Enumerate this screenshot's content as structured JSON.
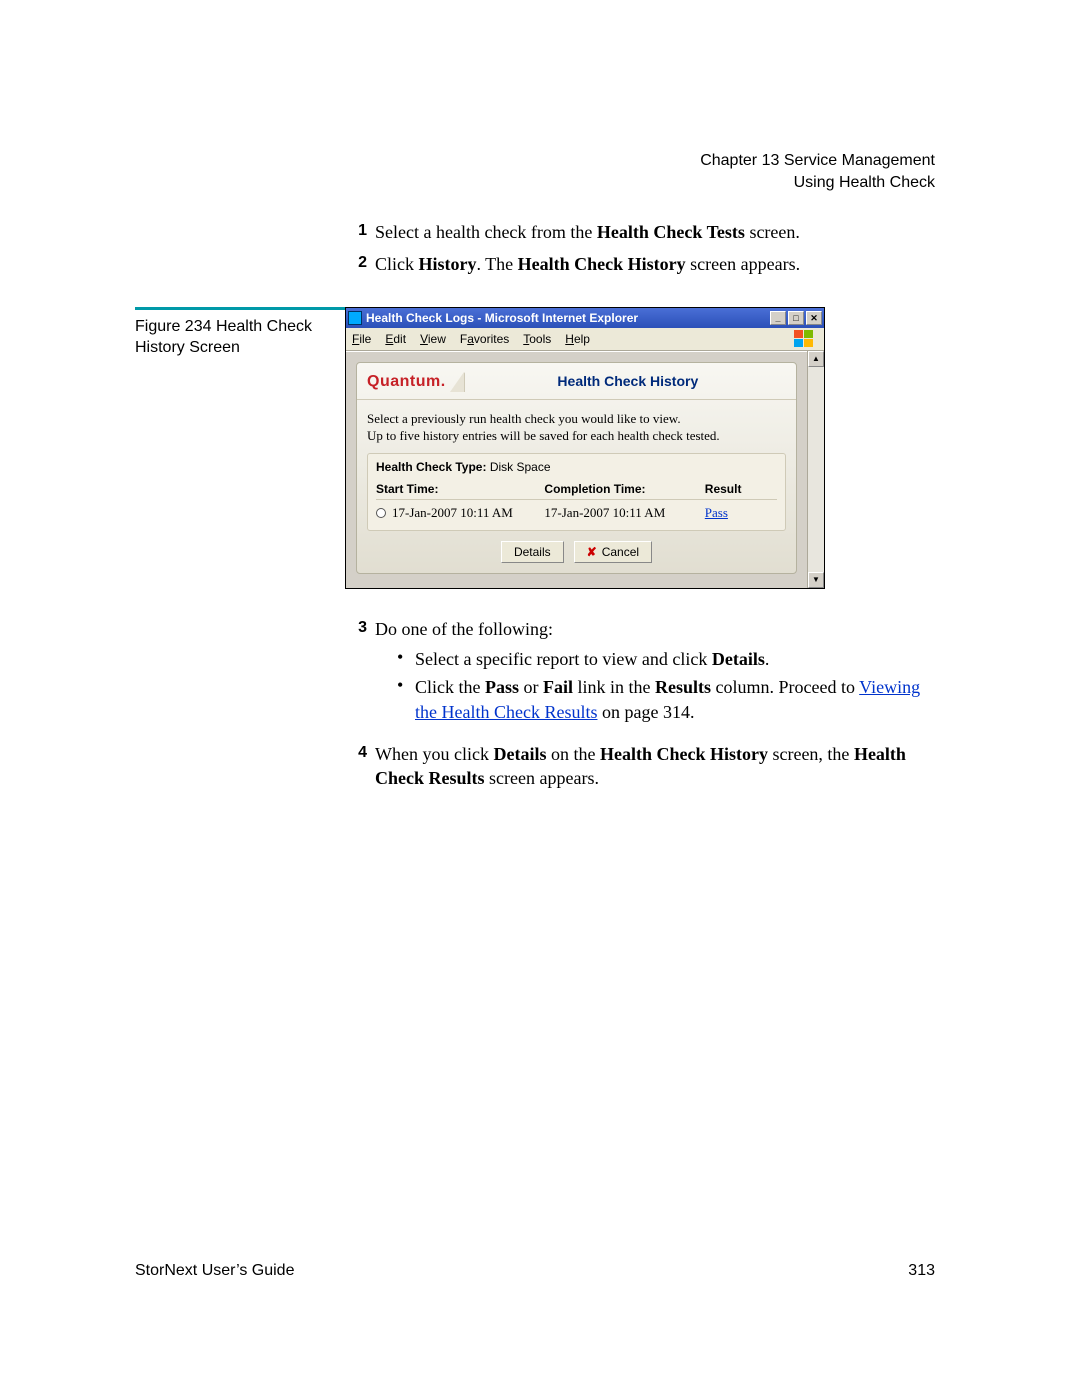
{
  "header": {
    "chapter_line": "Chapter 13  Service Management",
    "section_line": "Using Health Check"
  },
  "steps_a": [
    {
      "num": "1",
      "parts": [
        {
          "t": "plain",
          "v": "Select a health check from the "
        },
        {
          "t": "bold",
          "v": "Health Check Tests"
        },
        {
          "t": "plain",
          "v": " screen."
        }
      ]
    },
    {
      "num": "2",
      "parts": [
        {
          "t": "plain",
          "v": "Click "
        },
        {
          "t": "bold",
          "v": "History"
        },
        {
          "t": "plain",
          "v": ". The "
        },
        {
          "t": "bold",
          "v": "Health Check History"
        },
        {
          "t": "plain",
          "v": " screen appears."
        }
      ]
    }
  ],
  "figure": {
    "caption": "Figure 234  Health Check History Screen"
  },
  "ie": {
    "title": "Health Check Logs - Microsoft Internet Explorer",
    "menus": [
      {
        "pre": "",
        "u": "F",
        "post": "ile"
      },
      {
        "pre": "",
        "u": "E",
        "post": "dit"
      },
      {
        "pre": "",
        "u": "V",
        "post": "iew"
      },
      {
        "pre": "F",
        "u": "a",
        "post": "vorites"
      },
      {
        "pre": "",
        "u": "T",
        "post": "ools"
      },
      {
        "pre": "",
        "u": "H",
        "post": "elp"
      }
    ],
    "winbtns": {
      "min": "_",
      "max": "□",
      "close": "✕"
    },
    "scroll": {
      "up": "▲",
      "down": "▼"
    }
  },
  "panel": {
    "brand": "Quantum.",
    "title": "Health Check History",
    "desc_line1": "Select a previously run health check you would like to view.",
    "desc_line2": "Up to five history entries will be saved for each health check tested.",
    "type_label": "Health Check Type:",
    "type_value": "Disk Space",
    "columns": {
      "start": "Start Time:",
      "completion": "Completion Time:",
      "result": "Result"
    },
    "rows": [
      {
        "start": "17-Jan-2007 10:11 AM",
        "completion": "17-Jan-2007 10:11 AM",
        "result": "Pass"
      }
    ],
    "buttons": {
      "details": "Details",
      "cancel": "Cancel"
    }
  },
  "steps_b": [
    {
      "num": "3",
      "parts": [
        {
          "t": "plain",
          "v": "Do one of the following:"
        }
      ],
      "bullets": [
        [
          {
            "t": "plain",
            "v": "Select a specific report to view and click "
          },
          {
            "t": "bold",
            "v": "Details"
          },
          {
            "t": "plain",
            "v": "."
          }
        ],
        [
          {
            "t": "plain",
            "v": "Click the "
          },
          {
            "t": "bold",
            "v": "Pass"
          },
          {
            "t": "plain",
            "v": " or "
          },
          {
            "t": "bold",
            "v": "Fail"
          },
          {
            "t": "plain",
            "v": " link in the "
          },
          {
            "t": "bold",
            "v": "Results"
          },
          {
            "t": "plain",
            "v": " column. Proceed to "
          },
          {
            "t": "link",
            "v": "Viewing the Health Check Results"
          },
          {
            "t": "plain",
            "v": " on page  314."
          }
        ]
      ]
    },
    {
      "num": "4",
      "parts": [
        {
          "t": "plain",
          "v": "When you click "
        },
        {
          "t": "bold",
          "v": "Details"
        },
        {
          "t": "plain",
          "v": " on the "
        },
        {
          "t": "bold",
          "v": "Health Check History"
        },
        {
          "t": "plain",
          "v": " screen, the "
        },
        {
          "t": "bold",
          "v": "Health Check Results"
        },
        {
          "t": "plain",
          "v": " screen appears."
        }
      ]
    }
  ],
  "footer": {
    "left": "StorNext User’s Guide",
    "right": "313"
  }
}
